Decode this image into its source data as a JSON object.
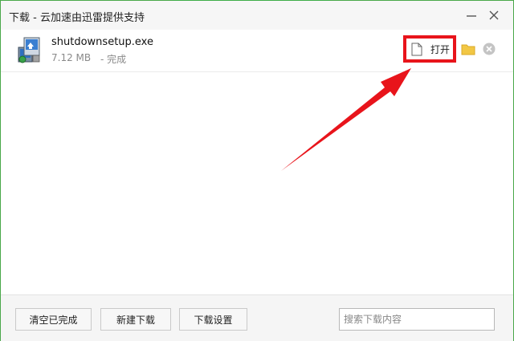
{
  "window": {
    "title": "下载 - 云加速由迅雷提供支持"
  },
  "download": {
    "file_name": "shutdownsetup.exe",
    "file_size": "7.12 MB",
    "status": "- 完成",
    "open_label": "打开"
  },
  "footer": {
    "clear_completed_label": "清空已完成",
    "new_download_label": "新建下载",
    "download_settings_label": "下载设置",
    "search_placeholder": "搜索下载内容"
  },
  "icons": {
    "file_icon": "installer-file-icon",
    "open_doc_icon": "document-icon",
    "folder_icon": "folder-icon",
    "remove_icon": "close-circle-icon",
    "minimize_icon": "minimize-icon",
    "close_icon": "close-icon"
  },
  "colors": {
    "accent": "#3fae49",
    "highlight": "#e8141b",
    "folder": "#f2c744"
  }
}
